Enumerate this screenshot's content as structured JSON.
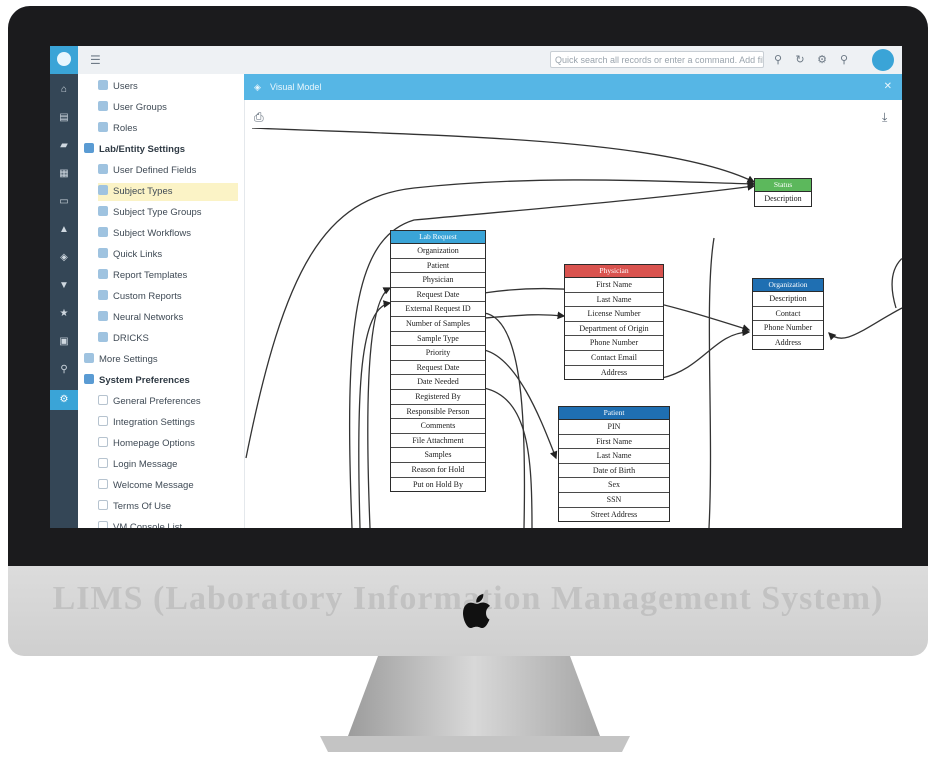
{
  "window": {
    "search_placeholder": "Quick search all records or enter a command. Add filter",
    "header_title": "Visual Model"
  },
  "chin_text": "LIMS (Laboratory Information Management System)",
  "topbar_icons": [
    "search-icon",
    "refresh-icon",
    "settings-icon",
    "help-icon"
  ],
  "rail_icons": [
    "home-icon",
    "inbox-icon",
    "chart-icon",
    "table-icon",
    "document-icon",
    "flask-icon",
    "tag-icon",
    "filter-icon",
    "star-icon",
    "calendar-icon",
    "search-icon",
    "settings-icon"
  ],
  "sidebar": {
    "items": [
      {
        "label": "Users",
        "level": 1,
        "kind": "item"
      },
      {
        "label": "User Groups",
        "level": 1,
        "kind": "item"
      },
      {
        "label": "Roles",
        "level": 1,
        "kind": "item"
      },
      {
        "label": "Lab/Entity Settings",
        "level": 0,
        "kind": "section"
      },
      {
        "label": "User Defined Fields",
        "level": 1,
        "kind": "item"
      },
      {
        "label": "Subject Types",
        "level": 1,
        "kind": "item",
        "selected": true
      },
      {
        "label": "Subject Type Groups",
        "level": 1,
        "kind": "item"
      },
      {
        "label": "Subject Workflows",
        "level": 1,
        "kind": "item"
      },
      {
        "label": "Quick Links",
        "level": 1,
        "kind": "item"
      },
      {
        "label": "Report Templates",
        "level": 1,
        "kind": "item"
      },
      {
        "label": "Custom Reports",
        "level": 1,
        "kind": "item"
      },
      {
        "label": "Neural Networks",
        "level": 1,
        "kind": "item"
      },
      {
        "label": "DRICKS",
        "level": 1,
        "kind": "item"
      },
      {
        "label": "More Settings",
        "level": 0,
        "kind": "collapsed"
      },
      {
        "label": "System Preferences",
        "level": 0,
        "kind": "section"
      },
      {
        "label": "General Preferences",
        "level": 1,
        "kind": "item"
      },
      {
        "label": "Integration Settings",
        "level": 1,
        "kind": "item"
      },
      {
        "label": "Homepage Options",
        "level": 1,
        "kind": "item"
      },
      {
        "label": "Login Message",
        "level": 1,
        "kind": "item"
      },
      {
        "label": "Welcome Message",
        "level": 1,
        "kind": "item"
      },
      {
        "label": "Terms Of Use",
        "level": 1,
        "kind": "item"
      },
      {
        "label": "VM Console List",
        "level": 1,
        "kind": "item"
      }
    ]
  },
  "diagram": {
    "entities": [
      {
        "id": "status",
        "title": "Status",
        "color": "#5cb85c",
        "fields": [
          "Description"
        ]
      },
      {
        "id": "lab-request",
        "title": "Lab Request",
        "color": "#3aa4d7",
        "fields": [
          "Organization",
          "Patient",
          "Physician",
          "Request Date",
          "External Request ID",
          "Number of Samples",
          "Sample Type",
          "Priority",
          "Request Date",
          "Date Needed",
          "Registered By",
          "Responsible Person",
          "Comments",
          "File Attachment",
          "Samples",
          "Reason for Hold",
          "Put on Hold By"
        ]
      },
      {
        "id": "physician",
        "title": "Physician",
        "color": "#d9534f",
        "fields": [
          "First Name",
          "Last Name",
          "License Number",
          "Department of Origin",
          "Phone Number",
          "Contact Email",
          "Address"
        ]
      },
      {
        "id": "organization",
        "title": "Organization",
        "color": "#1f6fb2",
        "fields": [
          "Description",
          "Contact",
          "Phone Number",
          "Address"
        ]
      },
      {
        "id": "patient",
        "title": "Patient",
        "color": "#1f6fb2",
        "fields": [
          "PIN",
          "First Name",
          "Last Name",
          "Date of Birth",
          "Sex",
          "SSN",
          "Street Address"
        ]
      }
    ]
  }
}
